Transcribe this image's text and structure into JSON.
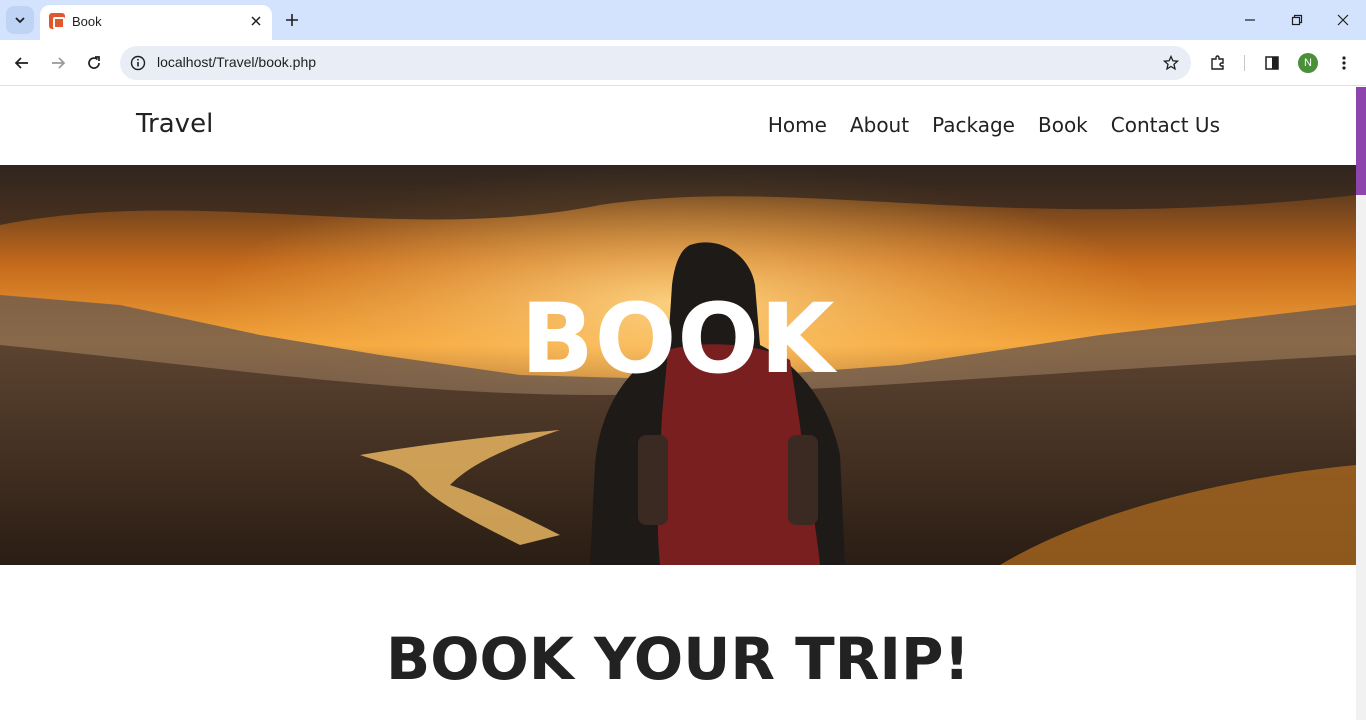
{
  "browser": {
    "tab_title": "Book",
    "url": "localhost/Travel/book.php",
    "profile_initial": "N"
  },
  "site": {
    "logo": "Travel",
    "nav": [
      "Home",
      "About",
      "Package",
      "Book",
      "Contact Us"
    ]
  },
  "hero": {
    "title": "BOOK"
  },
  "main": {
    "heading": "BOOK YOUR TRIP!"
  },
  "colors": {
    "scroll_thumb": "#8e44ad",
    "favicon": "#e0582a",
    "tabstrip": "#d3e3fd"
  }
}
